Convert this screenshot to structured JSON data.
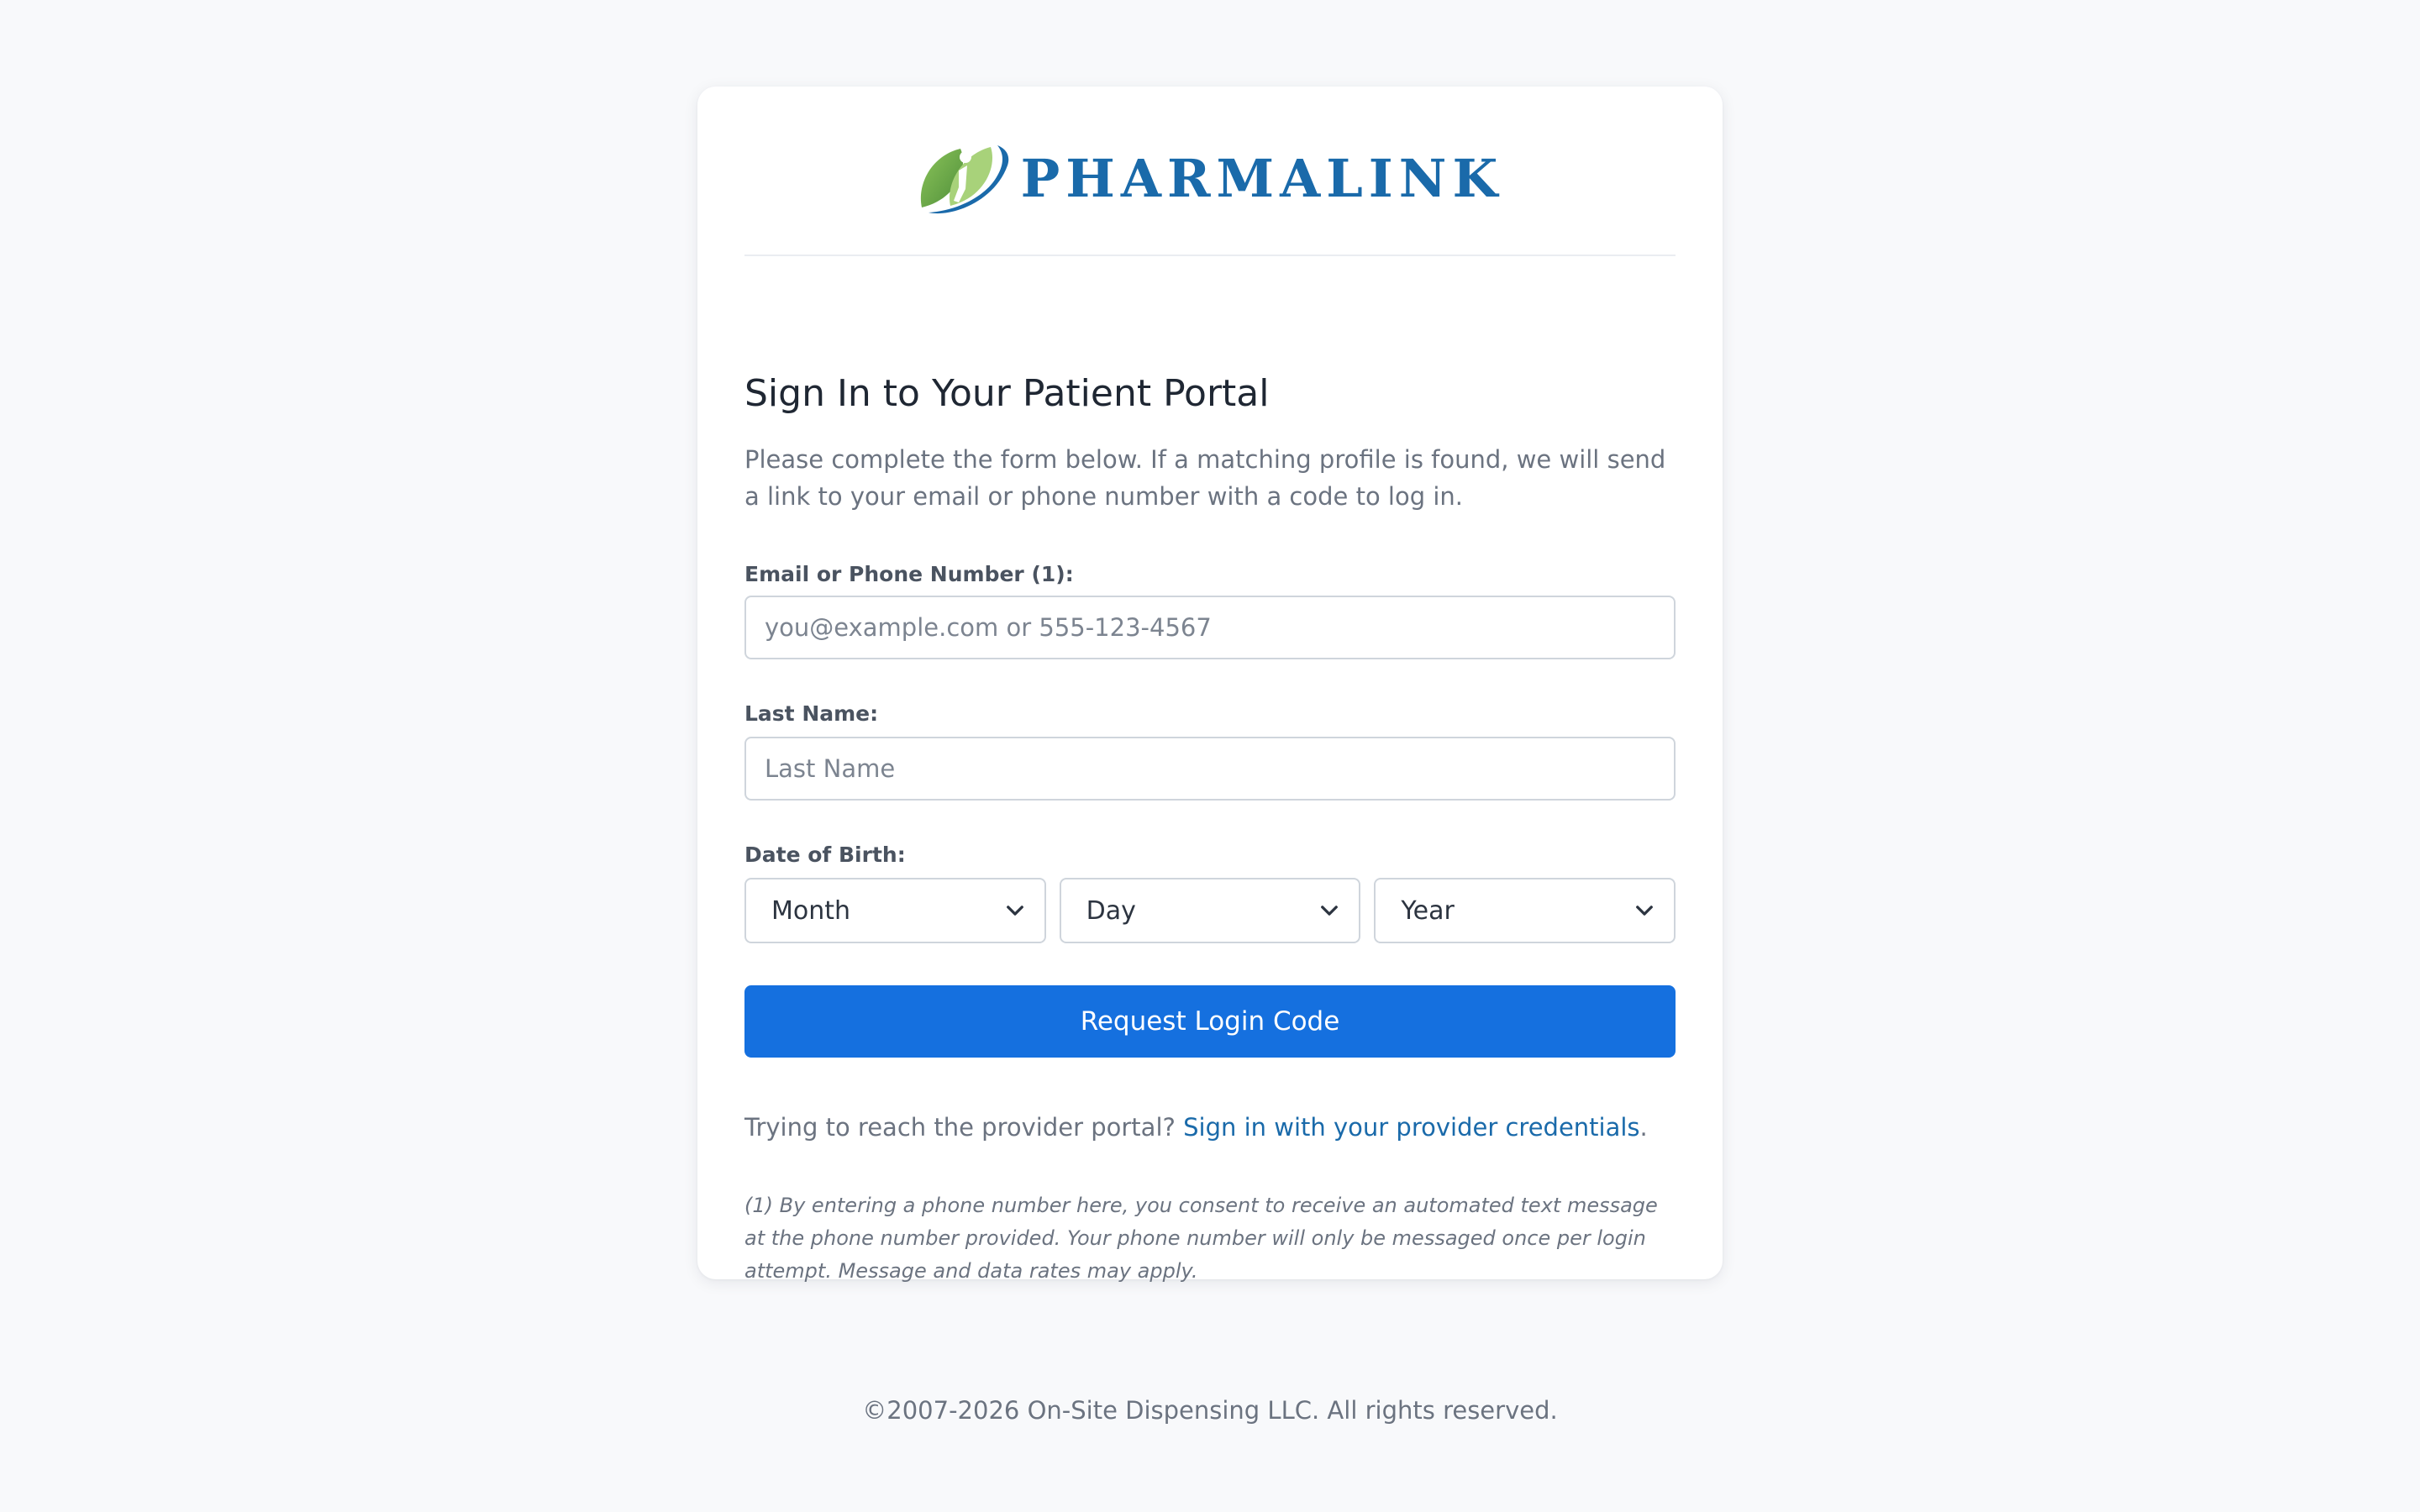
{
  "brand": {
    "name": "PHARMALINK",
    "colors": {
      "primary_blue": "#1a6aaa",
      "logo_green": "#6aac4e",
      "button_blue": "#1570df"
    }
  },
  "form": {
    "heading": "Sign In to Your Patient Portal",
    "intro": "Please complete the form below. If a matching profile is found, we will send a link to your email or phone number with a code to log in.",
    "contact_label": "Email or Phone Number (1):",
    "contact_placeholder": "you@example.com or 555-123-4567",
    "contact_value": "",
    "last_name_label": "Last Name:",
    "last_name_placeholder": "Last Name",
    "last_name_value": "",
    "dob_label": "Date of Birth:",
    "dob_month": "Month",
    "dob_day": "Day",
    "dob_year": "Year",
    "submit_label": "Request Login Code"
  },
  "provider": {
    "prompt": "Trying to reach the provider portal? ",
    "link_label": "Sign in with your provider credentials",
    "suffix": "."
  },
  "footnote": "(1) By entering a phone number here, you consent to receive an automated text message at the phone number provided. Your phone number will only be messaged once per login attempt. Message and data rates may apply.",
  "footer": {
    "copyright": "©2007-2026 On-Site Dispensing LLC. All rights reserved."
  }
}
